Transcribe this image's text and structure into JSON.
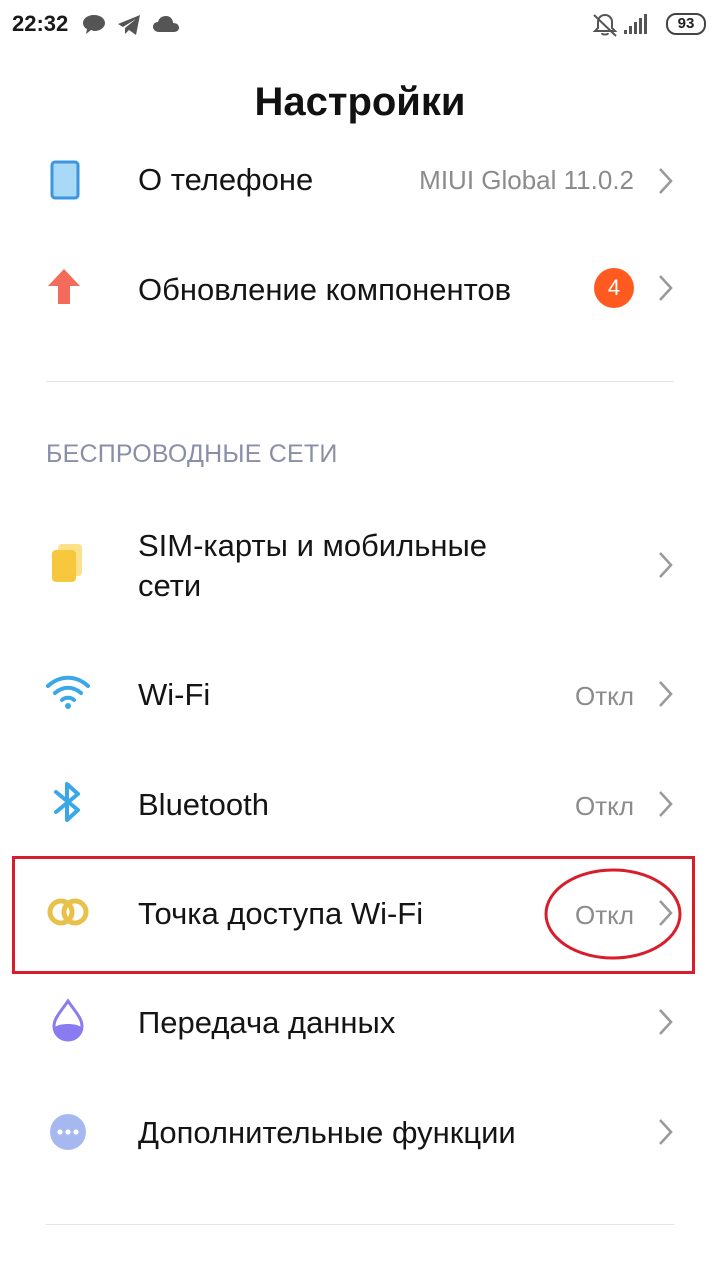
{
  "status_bar": {
    "time": "22:32",
    "battery": "93",
    "icons": [
      "chat-icon",
      "telegram-icon",
      "cloud-icon",
      "bell-muted-icon",
      "signal-icon",
      "battery-icon"
    ]
  },
  "header": {
    "title": "Настройки"
  },
  "top_items": [
    {
      "label": "О телефоне",
      "value": "MIUI Global 11.0.2",
      "icon": "phone-icon",
      "icon_color": "#4aa3e6"
    },
    {
      "label": "Обновление компонентов",
      "badge": "4",
      "icon": "arrow-up-icon",
      "icon_color": "#f26b5b"
    }
  ],
  "wireless": {
    "section_title": "БЕСПРОВОДНЫЕ СЕТИ",
    "items": [
      {
        "label": "SIM-карты и мобильные сети",
        "label_line1": "SIM-карты и мобильные",
        "label_line2": "сети",
        "icon": "sim-card-icon",
        "icon_color": "#f7c73e"
      },
      {
        "label": "Wi-Fi",
        "value": "Откл",
        "icon": "wifi-icon",
        "icon_color": "#3aa7e8"
      },
      {
        "label": "Bluetooth",
        "value": "Откл",
        "icon": "bluetooth-icon",
        "icon_color": "#3aa7e8"
      },
      {
        "label": "Точка доступа Wi-Fi",
        "value": "Откл",
        "icon": "hotspot-icon",
        "icon_color": "#e8c04a"
      },
      {
        "label": "Передача данных",
        "icon": "data-drop-icon",
        "icon_color": "#8a7cf0"
      },
      {
        "label": "Дополнительные функции",
        "icon": "more-dots-icon",
        "icon_color": "#a5b8f0"
      }
    ]
  },
  "colors": {
    "badge": "#ff5a1f",
    "annotation": "#d81d2c",
    "section_header": "#8a8fa8",
    "value_text": "#8b8b8b"
  }
}
